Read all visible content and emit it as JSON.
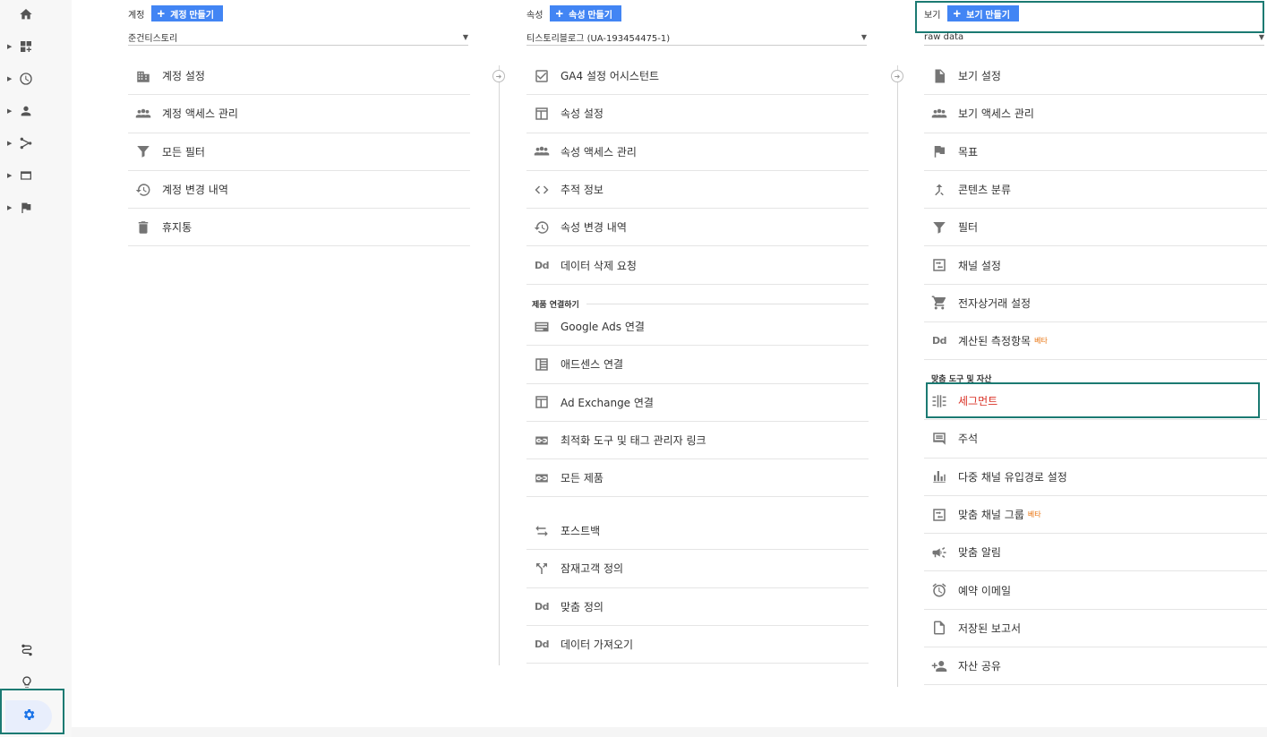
{
  "account": {
    "header_label": "계정",
    "create_label": "계정 만들기",
    "selected": "준건티스토리",
    "items": [
      {
        "label": "계정 설정",
        "icon": "building-icon"
      },
      {
        "label": "계정 액세스 관리",
        "icon": "people-icon"
      },
      {
        "label": "모든 필터",
        "icon": "filter-icon"
      },
      {
        "label": "계정 변경 내역",
        "icon": "history-icon"
      },
      {
        "label": "휴지통",
        "icon": "trash-icon"
      }
    ]
  },
  "property": {
    "header_label": "속성",
    "create_label": "속성 만들기",
    "selected": "티스토리블로그 (UA-193454475-1)",
    "items": [
      {
        "label": "GA4 설정 어시스턴트",
        "icon": "checkbox-icon"
      },
      {
        "label": "속성 설정",
        "icon": "window-icon"
      },
      {
        "label": "속성 액세스 관리",
        "icon": "people-icon"
      },
      {
        "label": "추적 정보",
        "icon": "code-icon"
      },
      {
        "label": "속성 변경 내역",
        "icon": "history-icon"
      },
      {
        "label": "데이터 삭제 요청",
        "icon": "dd-icon"
      }
    ],
    "product_linking_label": "제품 연결하기",
    "linking_items": [
      {
        "label": "Google Ads 연결",
        "icon": "ads-icon"
      },
      {
        "label": "애드센스 연결",
        "icon": "adsense-icon"
      },
      {
        "label": "Ad Exchange 연결",
        "icon": "window-icon"
      },
      {
        "label": "최적화 도구 및 태그 관리자 링크",
        "icon": "link-icon"
      },
      {
        "label": "모든 제품",
        "icon": "link-icon"
      }
    ],
    "extra_items": [
      {
        "label": "포스트백",
        "icon": "swap-icon"
      },
      {
        "label": "잠재고객 정의",
        "icon": "fork-icon"
      },
      {
        "label": "맞춤 정의",
        "icon": "dd-icon"
      },
      {
        "label": "데이터 가져오기",
        "icon": "dd-icon"
      }
    ]
  },
  "view": {
    "header_label": "보기",
    "create_label": "보기 만들기",
    "selected": "raw data",
    "items": [
      {
        "label": "보기 설정",
        "icon": "document-icon"
      },
      {
        "label": "보기 액세스 관리",
        "icon": "people-icon"
      },
      {
        "label": "목표",
        "icon": "flag-icon"
      },
      {
        "label": "콘텐츠 분류",
        "icon": "merge-icon"
      },
      {
        "label": "필터",
        "icon": "filter-icon"
      },
      {
        "label": "채널 설정",
        "icon": "channel-icon"
      },
      {
        "label": "전자상거래 설정",
        "icon": "cart-icon"
      },
      {
        "label": "계산된 측정항목",
        "icon": "dd-icon",
        "beta": "베타"
      }
    ],
    "personal_tools_label": "맞춤 도구 및 자산",
    "tools_items": [
      {
        "label": "세그먼트",
        "icon": "segment-icon",
        "active": true
      },
      {
        "label": "주석",
        "icon": "comment-icon"
      },
      {
        "label": "다중 채널 유입경로 설정",
        "icon": "bar-chart-icon"
      },
      {
        "label": "맞춤 채널 그룹",
        "icon": "channel-icon",
        "beta": "베타"
      },
      {
        "label": "맞춤 알림",
        "icon": "megaphone-icon"
      },
      {
        "label": "예약 이메일",
        "icon": "alarm-icon"
      },
      {
        "label": "저장된 보고서",
        "icon": "file-icon"
      },
      {
        "label": "자산 공유",
        "icon": "person-add-icon"
      }
    ]
  },
  "colors": {
    "accent": "#4285f4",
    "highlight_border": "#1b7a72",
    "active_text": "#d93025",
    "beta": "#e8710a"
  }
}
